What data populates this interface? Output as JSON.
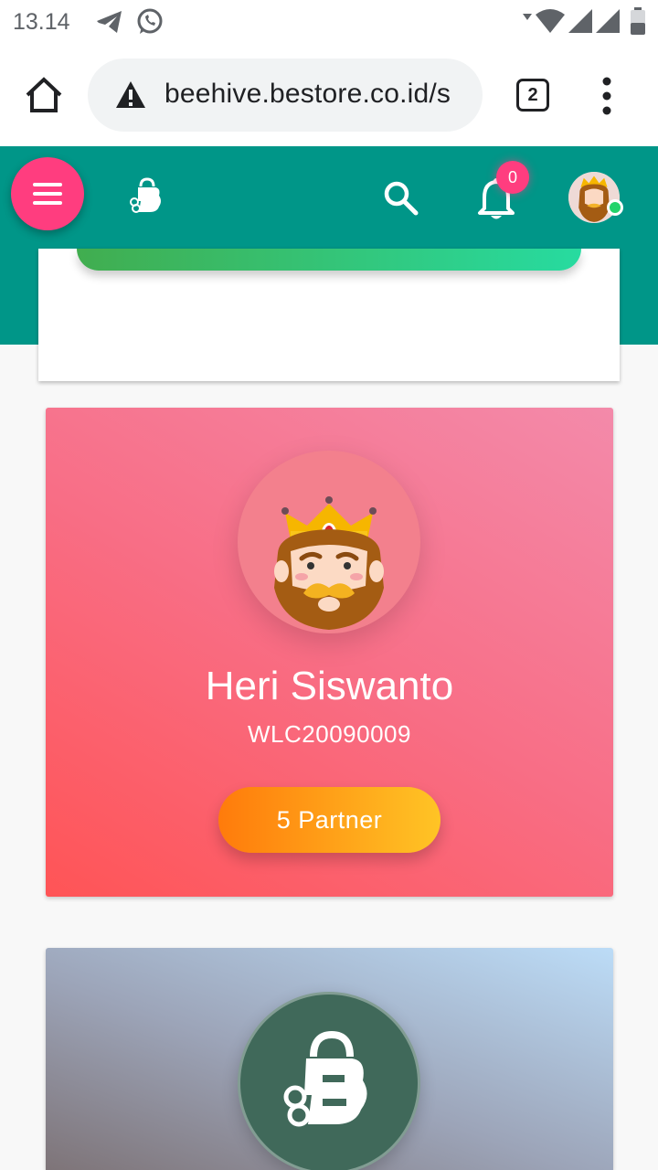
{
  "status_bar": {
    "time": "13.14"
  },
  "browser": {
    "url": "beehive.bestore.co.id/s",
    "tab_count": "2"
  },
  "header": {
    "notification_count": "0"
  },
  "profile": {
    "name": "Heri Siswanto",
    "member_id": "WLC20090009",
    "partner_button": "5 Partner"
  },
  "colors": {
    "header_bg": "#009688",
    "accent_pink": "#ff3d7f",
    "profile_gradient_start": "#ff5456",
    "profile_gradient_end": "#f38aaa",
    "partner_gradient_start": "#ff7b0b",
    "partner_gradient_end": "#ffc425",
    "brand_circle": "#40695a"
  },
  "icons": {
    "status": [
      "telegram-icon",
      "whatsapp-icon",
      "wifi-icon",
      "signal-icon",
      "battery-icon"
    ],
    "browser": [
      "home-icon",
      "warning-icon",
      "tabs-icon",
      "more-vert-icon"
    ],
    "header": [
      "menu-icon",
      "bestore-logo-icon",
      "search-icon",
      "bell-icon",
      "avatar-icon"
    ]
  }
}
